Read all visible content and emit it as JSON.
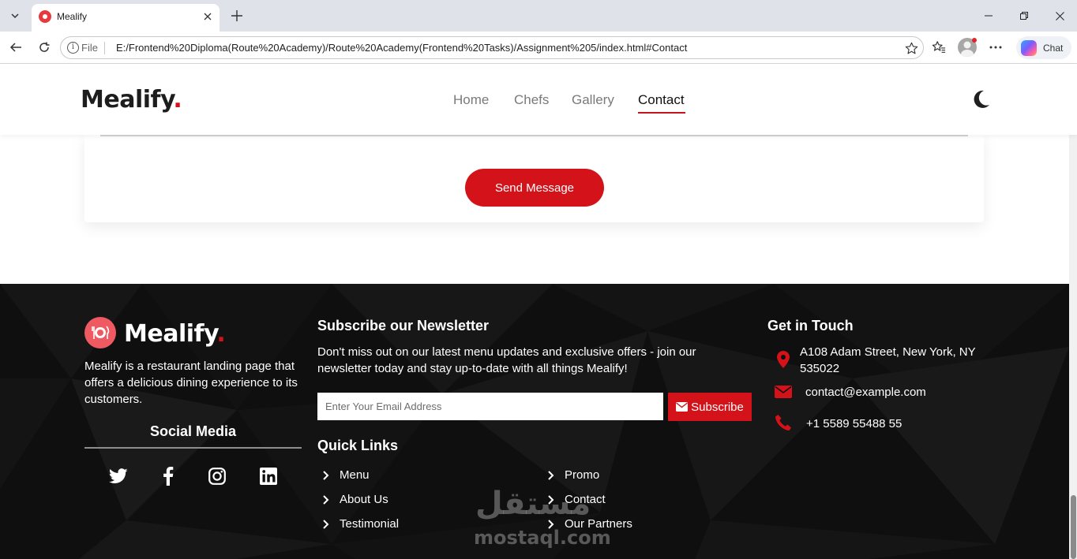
{
  "browser": {
    "tab_title": "Mealify",
    "file_label": "File",
    "url": "E:/Frontend%20Diploma(Route%20Academy)/Route%20Academy(Frontend%20Tasks)/Assignment%205/index.html#Contact",
    "chat_label": "Chat"
  },
  "header": {
    "brand": "Mealify",
    "brand_dot": ".",
    "nav": [
      {
        "label": "Home"
      },
      {
        "label": "Chefs"
      },
      {
        "label": "Gallery"
      },
      {
        "label": "Contact",
        "active": true
      }
    ]
  },
  "contact_form": {
    "send_label": "Send Message"
  },
  "footer": {
    "brand": "Mealify",
    "brand_dot": ".",
    "about": "Mealify is a restaurant landing page that offers a delicious dining experience to its customers.",
    "social_title": "Social Media",
    "social_icons": [
      "twitter-icon",
      "facebook-icon",
      "instagram-icon",
      "linkedin-icon"
    ],
    "newsletter": {
      "title": "Subscribe our Newsletter",
      "text": "Don't miss out on our latest menu updates and exclusive offers - join our newsletter today and stay up-to-date with all things Mealify!",
      "placeholder": "Enter Your Email Address",
      "button": "Subscribe"
    },
    "quick_links": {
      "title": "Quick Links",
      "left": [
        "Menu",
        "About Us",
        "Testimonial"
      ],
      "right": [
        "Promo",
        "Contact",
        "Our Partners"
      ]
    },
    "get_in_touch": {
      "title": "Get in Touch",
      "address_line1": "A108 Adam Street, New York, NY",
      "address_line2": "535022",
      "email": "contact@example.com",
      "phone": "+1 5589 55488 55"
    },
    "watermark": {
      "arabic": "مستقل",
      "latin": "mostaql.com"
    }
  },
  "colors": {
    "accent": "#d3121a",
    "footer_bg": "#0f0f0f"
  }
}
